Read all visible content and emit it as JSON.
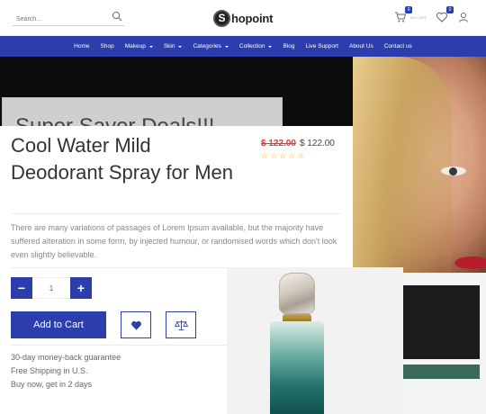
{
  "header": {
    "search_placeholder": "Search...",
    "logo_text": "hopoint",
    "logo_mark": "S",
    "cart_count": "0",
    "cart_sub": "MY CART",
    "wishlist_count": "0",
    "icons": [
      "search-icon",
      "cart-icon",
      "heart-icon",
      "user-icon"
    ]
  },
  "nav": {
    "items": [
      {
        "label": "Home",
        "dropdown": false
      },
      {
        "label": "Shop",
        "dropdown": false
      },
      {
        "label": "Makeup",
        "dropdown": true
      },
      {
        "label": "Skin",
        "dropdown": true
      },
      {
        "label": "Categories",
        "dropdown": true
      },
      {
        "label": "Collection",
        "dropdown": true
      },
      {
        "label": "Blog",
        "dropdown": false
      },
      {
        "label": "Live Support",
        "dropdown": false
      },
      {
        "label": "About Us",
        "dropdown": false
      },
      {
        "label": "Contact us",
        "dropdown": false
      }
    ]
  },
  "banner": {
    "text": "Super Saver Deals!!!"
  },
  "product": {
    "title": "Cool Water Mild Deodorant Spray for Men",
    "old_price": "$ 122.00",
    "new_price": "$ 122.00",
    "description": "There are many variations of passages of Lorem Ipsum available, but the majority have suffered alteration in some form, by injected humour, or randomised words which don't look even slightly believable.",
    "quantity": "1",
    "minus_label": "−",
    "plus_label": "+",
    "add_to_cart_label": "Add to Cart",
    "features": [
      "30-day money-back guarantee",
      "Free Shipping in U.S.",
      "Buy now, get in 2 days"
    ]
  },
  "colors": {
    "brand": "#2b3eab",
    "sale": "#e03a3a",
    "star": "#f0b51f"
  }
}
